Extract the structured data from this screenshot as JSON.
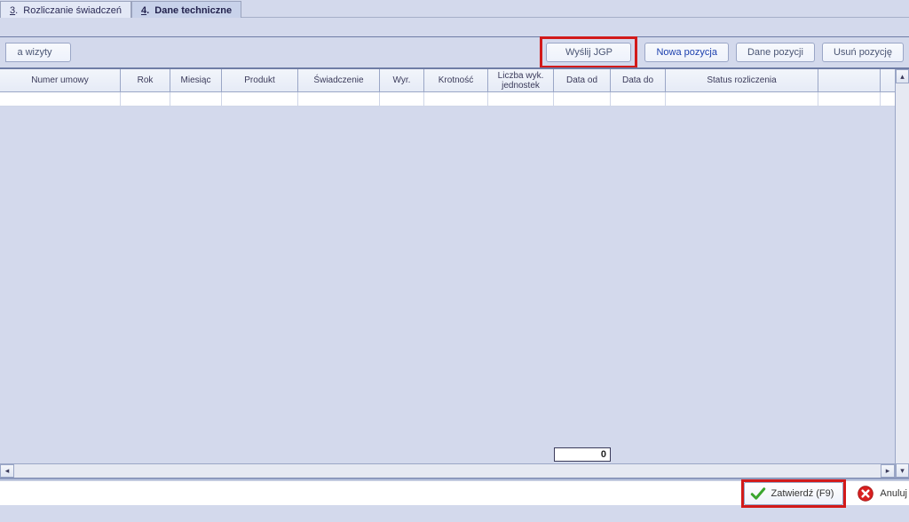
{
  "tabs": {
    "tab3": {
      "num": "3",
      "label": "Rozliczanie świadczeń"
    },
    "tab4": {
      "num": "4",
      "label": "Dane techniczne"
    }
  },
  "toolbar": {
    "truncated_label": "a wizyty",
    "btn_send_jgp": "Wyślij JGP",
    "btn_new_pos": "Nowa pozycja",
    "btn_data_pos": "Dane pozycji",
    "btn_delete_pos": "Usuń pozycję"
  },
  "grid": {
    "headers": {
      "h0": "Numer umowy",
      "h1": "Rok",
      "h2": "Miesiąc",
      "h3": "Produkt",
      "h4": "Świadczenie",
      "h5": "Wyr.",
      "h6": "Krotność",
      "h7": "Liczba wyk. jednostek",
      "h8": "Data od",
      "h9": "Data do",
      "h10": "Status rozliczenia",
      "h11": ""
    },
    "sum_value": "0",
    "rows": []
  },
  "actions": {
    "confirm": "Zatwierdź (F9)",
    "cancel": "Anuluj"
  }
}
